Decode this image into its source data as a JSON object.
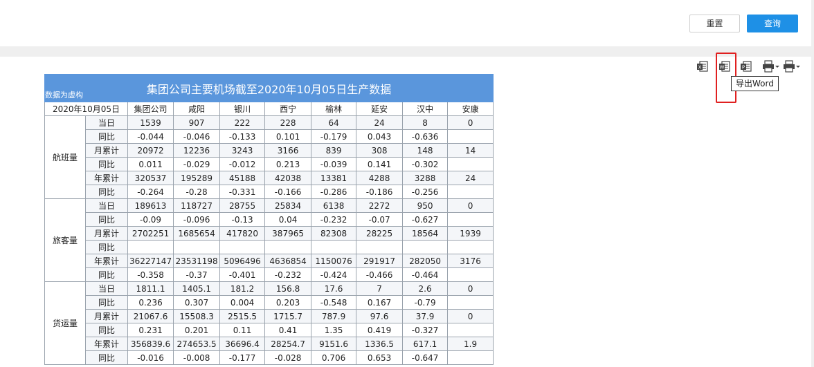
{
  "filter": {
    "reset_label": "重置",
    "query_label": "查询"
  },
  "toolbar": {
    "items": [
      {
        "name": "export-excel-icon"
      },
      {
        "name": "export-word-icon"
      },
      {
        "name": "export-pdf-icon"
      },
      {
        "name": "print-icon"
      },
      {
        "name": "print-options-icon"
      }
    ],
    "tooltip": "导出Word"
  },
  "report": {
    "title": "集团公司主要机场截至2020年10月05日生产数据",
    "note": "数据为虚构",
    "date_header": "2020年10月05日",
    "columns": [
      "集团公司",
      "咸阳",
      "银川",
      "西宁",
      "榆林",
      "延安",
      "汉中",
      "安康"
    ],
    "groups": [
      {
        "name": "航班量",
        "rows": [
          {
            "metric": "当日",
            "values": [
              "1539",
              "907",
              "222",
              "228",
              "64",
              "24",
              "8",
              "0"
            ]
          },
          {
            "metric": "同比",
            "values": [
              "-0.044",
              "-0.046",
              "-0.133",
              "0.101",
              "-0.179",
              "0.043",
              "-0.636",
              ""
            ]
          },
          {
            "metric": "月累计",
            "values": [
              "20972",
              "12236",
              "3243",
              "3166",
              "839",
              "308",
              "148",
              "14"
            ]
          },
          {
            "metric": "同比",
            "values": [
              "0.011",
              "-0.029",
              "-0.012",
              "0.213",
              "-0.039",
              "0.141",
              "-0.302",
              ""
            ]
          },
          {
            "metric": "年累计",
            "values": [
              "320537",
              "195289",
              "45188",
              "42038",
              "13381",
              "4288",
              "3288",
              "24"
            ]
          },
          {
            "metric": "同比",
            "values": [
              "-0.264",
              "-0.28",
              "-0.331",
              "-0.166",
              "-0.286",
              "-0.186",
              "-0.256",
              ""
            ]
          }
        ]
      },
      {
        "name": "旅客量",
        "rows": [
          {
            "metric": "当日",
            "values": [
              "189613",
              "118727",
              "28755",
              "25834",
              "6138",
              "2272",
              "950",
              "0"
            ]
          },
          {
            "metric": "同比",
            "values": [
              "-0.09",
              "-0.096",
              "-0.13",
              "0.04",
              "-0.232",
              "-0.07",
              "-0.627",
              ""
            ]
          },
          {
            "metric": "月累计",
            "values": [
              "2702251",
              "1685654",
              "417820",
              "387965",
              "82308",
              "28225",
              "18564",
              "1939"
            ]
          },
          {
            "metric": "同比",
            "values": [
              "",
              "",
              "",
              "",
              "",
              "",
              "",
              ""
            ]
          },
          {
            "metric": "年累计",
            "values": [
              "36227147",
              "23531198",
              "5096496",
              "4636854",
              "1150076",
              "291917",
              "282050",
              "3176"
            ]
          },
          {
            "metric": "同比",
            "values": [
              "-0.358",
              "-0.37",
              "-0.401",
              "-0.232",
              "-0.424",
              "-0.466",
              "-0.464",
              ""
            ]
          }
        ]
      },
      {
        "name": "货运量",
        "rows": [
          {
            "metric": "当日",
            "values": [
              "1811.1",
              "1405.1",
              "181.2",
              "156.8",
              "17.6",
              "7",
              "2.6",
              "0"
            ]
          },
          {
            "metric": "同比",
            "values": [
              "0.236",
              "0.307",
              "0.004",
              "0.203",
              "-0.548",
              "0.167",
              "-0.79",
              ""
            ]
          },
          {
            "metric": "月累计",
            "values": [
              "21067.6",
              "15508.3",
              "2515.5",
              "1715.7",
              "787.9",
              "97.6",
              "37.9",
              "0"
            ]
          },
          {
            "metric": "同比",
            "values": [
              "0.231",
              "0.201",
              "0.11",
              "0.41",
              "1.35",
              "0.419",
              "-0.327",
              ""
            ]
          },
          {
            "metric": "年累计",
            "values": [
              "356839.6",
              "274653.5",
              "36696.4",
              "28254.7",
              "9151.6",
              "1336.5",
              "617.1",
              "1.9"
            ]
          },
          {
            "metric": "同比",
            "values": [
              "-0.016",
              "-0.008",
              "-0.177",
              "-0.028",
              "0.706",
              "0.653",
              "-0.647",
              ""
            ]
          }
        ]
      }
    ]
  }
}
